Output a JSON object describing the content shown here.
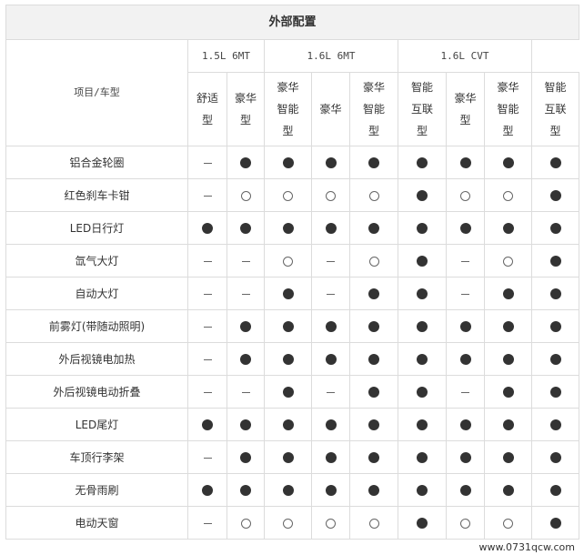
{
  "title": "外部配置",
  "row_header": "项目/车型",
  "engines": [
    {
      "label": "1.5L  6MT",
      "span": 2
    },
    {
      "label": "1.6L  6MT",
      "span": 3
    },
    {
      "label": "1.6L  CVT",
      "span": 3
    }
  ],
  "trims": [
    "舒适型",
    "豪华型",
    "豪华智能型",
    "豪华",
    "豪华智能型",
    "智能互联型",
    "豪华型",
    "豪华智能型",
    "智能互联型"
  ],
  "legend_values": {
    "standard": "●",
    "optional": "○",
    "none": "–"
  },
  "rows": [
    {
      "label": "铝合金轮圈",
      "values": [
        "none",
        "std",
        "std",
        "std",
        "std",
        "std",
        "std",
        "std",
        "std"
      ]
    },
    {
      "label": "红色刹车卡钳",
      "values": [
        "none",
        "opt",
        "opt",
        "opt",
        "opt",
        "std",
        "opt",
        "opt",
        "std"
      ]
    },
    {
      "label": "LED日行灯",
      "values": [
        "std",
        "std",
        "std",
        "std",
        "std",
        "std",
        "std",
        "std",
        "std"
      ]
    },
    {
      "label": "氙气大灯",
      "values": [
        "none",
        "none",
        "opt",
        "none",
        "opt",
        "std",
        "none",
        "opt",
        "std"
      ]
    },
    {
      "label": "自动大灯",
      "values": [
        "none",
        "none",
        "std",
        "none",
        "std",
        "std",
        "none",
        "std",
        "std"
      ]
    },
    {
      "label": "前雾灯(带随动照明)",
      "values": [
        "none",
        "std",
        "std",
        "std",
        "std",
        "std",
        "std",
        "std",
        "std"
      ]
    },
    {
      "label": "外后视镜电加热",
      "values": [
        "none",
        "std",
        "std",
        "std",
        "std",
        "std",
        "std",
        "std",
        "std"
      ]
    },
    {
      "label": "外后视镜电动折叠",
      "values": [
        "none",
        "none",
        "std",
        "none",
        "std",
        "std",
        "none",
        "std",
        "std"
      ]
    },
    {
      "label": "LED尾灯",
      "values": [
        "std",
        "std",
        "std",
        "std",
        "std",
        "std",
        "std",
        "std",
        "std"
      ]
    },
    {
      "label": "车顶行李架",
      "values": [
        "none",
        "std",
        "std",
        "std",
        "std",
        "std",
        "std",
        "std",
        "std"
      ]
    },
    {
      "label": "无骨雨刷",
      "values": [
        "std",
        "std",
        "std",
        "std",
        "std",
        "std",
        "std",
        "std",
        "std"
      ]
    },
    {
      "label": "电动天窗",
      "values": [
        "none",
        "opt",
        "opt",
        "opt",
        "opt",
        "std",
        "opt",
        "opt",
        "std"
      ]
    }
  ],
  "watermark": "www.0731qcw.com"
}
